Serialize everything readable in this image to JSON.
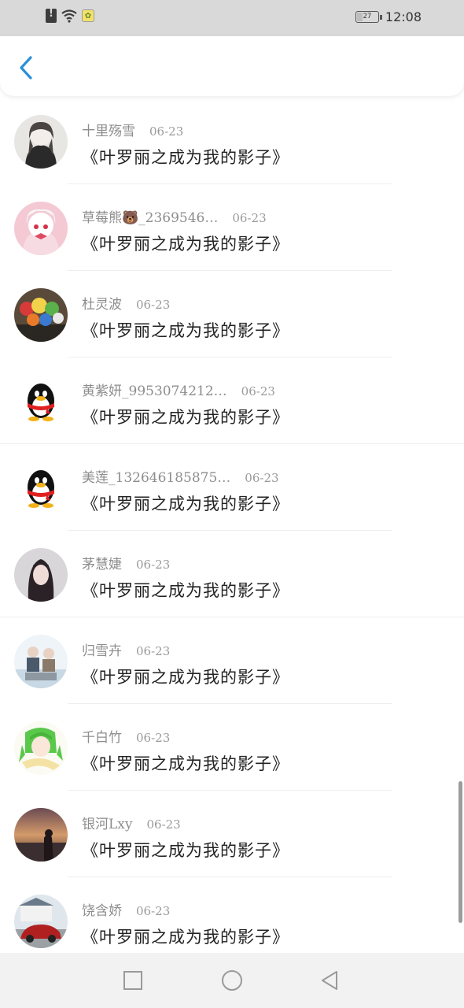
{
  "status_bar": {
    "time": "12:08",
    "battery_level": "27",
    "icons": [
      "alert-icon",
      "wifi-icon",
      "app-notification-icon",
      "battery-icon"
    ]
  },
  "header": {
    "back_icon": "chevron-left-icon",
    "accent_color": "#2a8fd8"
  },
  "messages": [
    {
      "name": "十里殇雪",
      "date": "06-23",
      "text": "《叶罗丽之成为我的影子》",
      "avatar": "girl-sketch"
    },
    {
      "name": "草莓熊🐻_2369546…",
      "date": "06-23",
      "text": "《叶罗丽之成为我的影子》",
      "avatar": "pink-anime"
    },
    {
      "name": "杜灵波",
      "date": "06-23",
      "text": "《叶罗丽之成为我的影子》",
      "avatar": "toys"
    },
    {
      "name": "黄紫妍_9953074212…",
      "date": "06-23",
      "text": "《叶罗丽之成为我的影子》",
      "avatar": "qq-penguin"
    },
    {
      "name": "美莲_132646185875…",
      "date": "06-23",
      "text": "《叶罗丽之成为我的影子》",
      "avatar": "qq-penguin"
    },
    {
      "name": "茅慧婕",
      "date": "06-23",
      "text": "《叶罗丽之成为我的影子》",
      "avatar": "girl-photo"
    },
    {
      "name": "归雪卉",
      "date": "06-23",
      "text": "《叶罗丽之成为我的影子》",
      "avatar": "couple"
    },
    {
      "name": "千白竹",
      "date": "06-23",
      "text": "《叶罗丽之成为我的影子》",
      "avatar": "green-anime"
    },
    {
      "name": "银河Lxy",
      "date": "06-23",
      "text": "《叶罗丽之成为我的影子》",
      "avatar": "sunset"
    },
    {
      "name": "饶含娇",
      "date": "06-23",
      "text": "《叶罗丽之成为我的影子》",
      "avatar": "car"
    }
  ],
  "nav_bar": {
    "buttons": [
      "recent-apps-square-icon",
      "home-circle-icon",
      "back-triangle-icon"
    ]
  }
}
